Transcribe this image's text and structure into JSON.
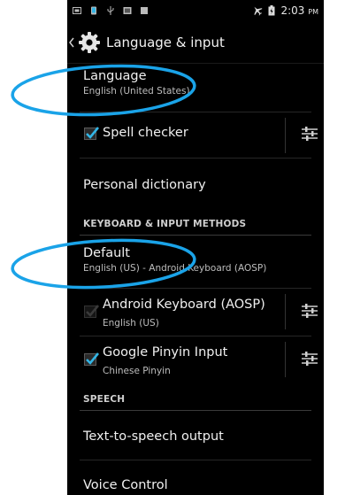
{
  "status_bar": {
    "time": "2:03",
    "ampm": "PM"
  },
  "action_bar": {
    "title": "Language & input"
  },
  "items": {
    "language": {
      "title": "Language",
      "subtitle": "English (United States)"
    },
    "spell_checker": {
      "title": "Spell checker",
      "checked": true
    },
    "personal_dictionary": {
      "title": "Personal dictionary"
    },
    "default": {
      "title": "Default",
      "subtitle": "English (US) - Android Keyboard (AOSP)"
    },
    "android_keyboard": {
      "title": "Android Keyboard (AOSP)",
      "subtitle": "English (US)",
      "checked": true,
      "enabled": false
    },
    "google_pinyin": {
      "title": "Google Pinyin Input",
      "subtitle": "Chinese Pinyin",
      "checked": true
    },
    "tts": {
      "title": "Text-to-speech output"
    },
    "voice_control": {
      "title": "Voice Control"
    }
  },
  "sections": {
    "keyboard": "KEYBOARD & INPUT METHODS",
    "speech": "SPEECH"
  },
  "colors": {
    "check_blue": "#33b5e5",
    "annotation_blue": "#1aa3e8",
    "background": "#000000"
  }
}
